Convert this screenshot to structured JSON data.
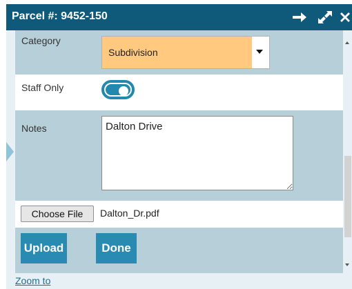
{
  "header": {
    "title": "Parcel #: 9452-150",
    "icons": [
      "arrow-right-icon",
      "expand-icon",
      "close-icon"
    ]
  },
  "form": {
    "category": {
      "label": "Category",
      "value": "Subdivision"
    },
    "staff_only": {
      "label": "Staff Only",
      "on": true
    },
    "notes": {
      "label": "Notes",
      "value": "Dalton Drive"
    },
    "file": {
      "button_label": "Choose File",
      "file_name": "Dalton_Dr.pdf"
    },
    "actions": {
      "upload_label": "Upload",
      "done_label": "Done"
    }
  },
  "footer": {
    "zoom_link": "Zoom to"
  },
  "colors": {
    "header_bg": "#0f5a7a",
    "row_blue": "#b7cfd8",
    "select_highlight": "#ffc97f",
    "accent": "#2a8bb2",
    "toggle": "#2288ad"
  }
}
